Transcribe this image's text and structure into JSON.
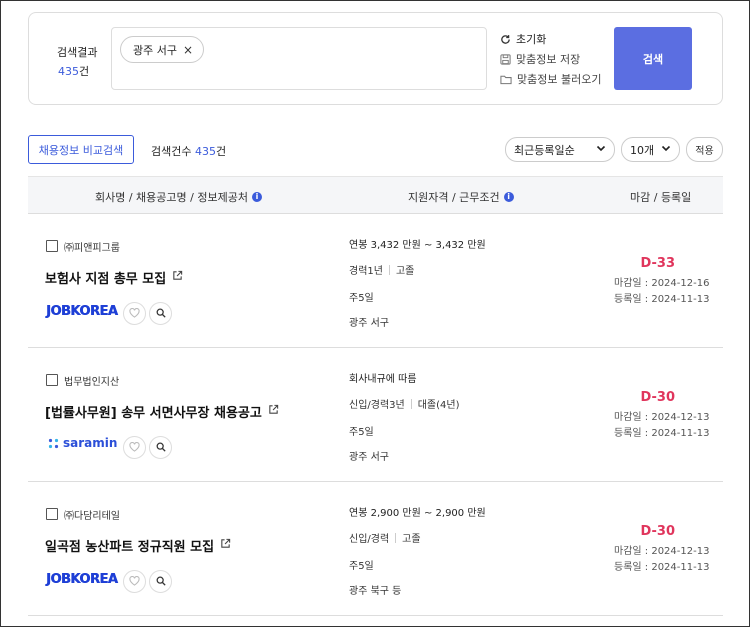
{
  "search": {
    "result_label": "검색결과",
    "result_count": "435",
    "result_unit": "건",
    "chip": "광주 서구",
    "chip_remove": "×",
    "reset": "초기화",
    "save_custom": "맞춤정보 저장",
    "load_custom": "맞춤정보 불러오기",
    "search_button": "검색"
  },
  "toolbar": {
    "compare_button": "채용정보 비교검색",
    "count_label": "검색건수",
    "count": "435",
    "count_unit": "건",
    "sort_selected": "최근등록일순",
    "size_selected": "10개",
    "apply_button": "적용"
  },
  "table": {
    "header_company": "회사명 / 채용공고명 / 정보제공처",
    "header_conditions": "지원자격 / 근무조건",
    "header_dates": "마감 / 등록일",
    "info_icon": "i"
  },
  "rows": [
    {
      "company": "㈜피앤피그룹",
      "title": "보험사 지점 총무 모집",
      "source": "JOBKOREA",
      "salary": "연봉 3,432 만원 ~ 3,432 만원",
      "career": "경력1년",
      "education": "고졸",
      "workdays": "주5일",
      "location": "광주 서구",
      "dday": "D-33",
      "deadline": "마감일 : 2024-12-16",
      "registered": "등록일 : 2024-11-13"
    },
    {
      "company": "법무법인지산",
      "title": "[법률사무원] 송무 서면사무장 채용공고",
      "source": "saramin",
      "salary": "회사내규에 따름",
      "career": "신입/경력3년",
      "education": "대졸(4년)",
      "workdays": "주5일",
      "location": "광주 서구",
      "dday": "D-30",
      "deadline": "마감일 : 2024-12-13",
      "registered": "등록일 : 2024-11-13"
    },
    {
      "company": "㈜다담리테일",
      "title": "일곡점 농산파트 정규직원 모집",
      "source": "JOBKOREA",
      "salary": "연봉 2,900 만원 ~ 2,900 만원",
      "career": "신입/경력",
      "education": "고졸",
      "workdays": "주5일",
      "location": "광주 북구 등",
      "dday": "D-30",
      "deadline": "마감일 : 2024-12-13",
      "registered": "등록일 : 2024-11-13"
    }
  ],
  "colors": {
    "accent": "#3b5bdb",
    "search_button": "#5b6ee1",
    "dday": "#e0355c"
  },
  "icons": [
    "refresh-icon",
    "save-icon",
    "folder-icon",
    "external-link-icon",
    "heart-icon",
    "search-icon",
    "chevron-down-icon",
    "info-icon",
    "close-icon"
  ]
}
